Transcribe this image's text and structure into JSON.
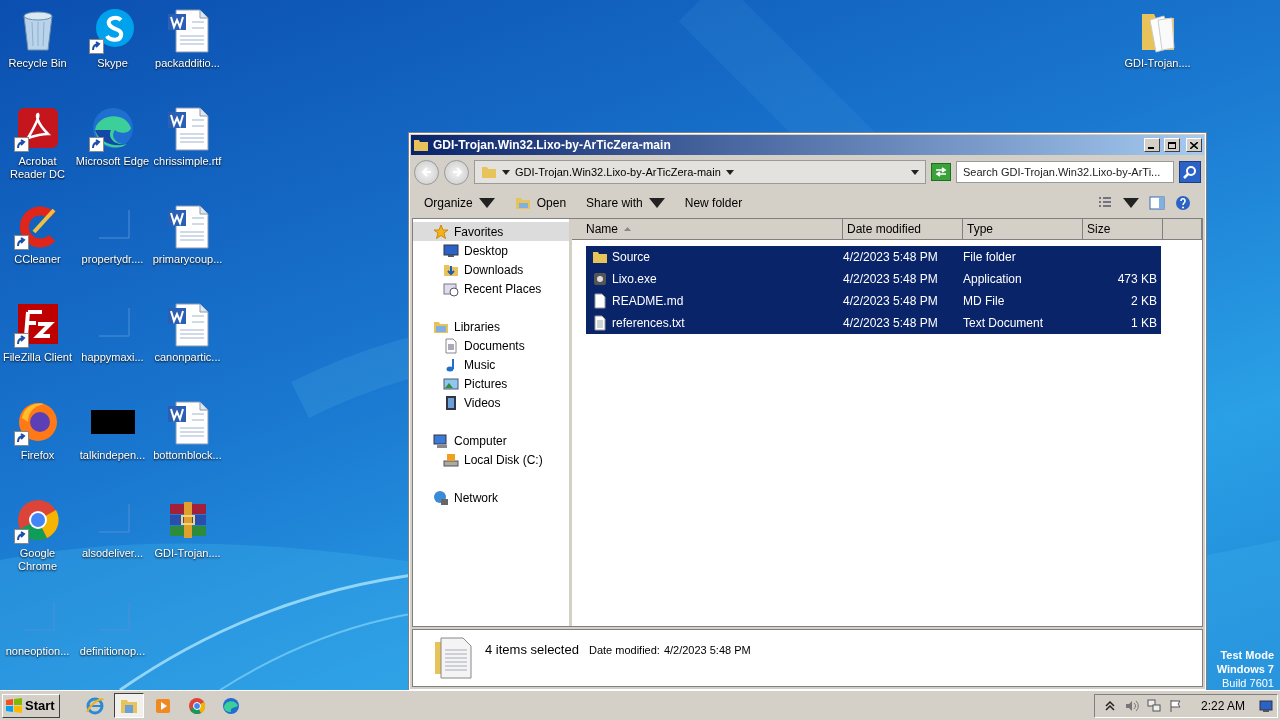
{
  "desktop": {
    "icons": [
      {
        "label": "Recycle Bin",
        "kind": "recycle",
        "shortcut": false
      },
      {
        "label": "Acrobat Reader DC",
        "kind": "acrobat",
        "shortcut": true
      },
      {
        "label": "CCleaner",
        "kind": "ccleaner",
        "shortcut": true
      },
      {
        "label": "FileZilla Client",
        "kind": "filezilla",
        "shortcut": true
      },
      {
        "label": "Firefox",
        "kind": "firefox",
        "shortcut": true
      },
      {
        "label": "Google Chrome",
        "kind": "chrome",
        "shortcut": true
      },
      {
        "label": "noneoption...",
        "kind": "blank",
        "shortcut": false
      },
      {
        "label": "Skype",
        "kind": "skype",
        "shortcut": true
      },
      {
        "label": "Microsoft Edge",
        "kind": "edge",
        "shortcut": true
      },
      {
        "label": "propertydr....",
        "kind": "blank",
        "shortcut": false
      },
      {
        "label": "happymaxi...",
        "kind": "blank",
        "shortcut": false
      },
      {
        "label": "talkindepen...",
        "kind": "black",
        "shortcut": false
      },
      {
        "label": "alsodeliver...",
        "kind": "blank",
        "shortcut": false
      },
      {
        "label": "definitionop...",
        "kind": "blank",
        "shortcut": false
      },
      {
        "label": "packadditio...",
        "kind": "word",
        "shortcut": false
      },
      {
        "label": "chrissimple.rtf",
        "kind": "word",
        "shortcut": false
      },
      {
        "label": "primarycoup...",
        "kind": "word",
        "shortcut": false
      },
      {
        "label": "canonpartic...",
        "kind": "word",
        "shortcut": false
      },
      {
        "label": "bottomblock...",
        "kind": "word",
        "shortcut": false
      },
      {
        "label": "GDI-Trojan....",
        "kind": "winrar",
        "shortcut": false
      }
    ],
    "corner_icon": {
      "label": "GDI-Trojan....",
      "kind": "folder",
      "shortcut": false
    }
  },
  "explorer": {
    "title": "GDI-Trojan.Win32.Lixo-by-ArTicZera-main",
    "address": {
      "path": "GDI-Trojan.Win32.Lixo-by-ArTicZera-main"
    },
    "search": {
      "placeholder": "Search GDI-Trojan.Win32.Lixo-by-ArTi..."
    },
    "toolbar": [
      {
        "label": "Organize",
        "kind": "menu"
      },
      {
        "label": "Open",
        "kind": "open"
      },
      {
        "label": "Share with",
        "kind": "menu"
      },
      {
        "label": "New folder",
        "kind": "plain"
      }
    ],
    "nav": [
      {
        "label": "Favorites",
        "kind": "star",
        "selected": true,
        "children": [
          {
            "label": "Desktop",
            "kind": "desktop",
            "selected": false
          },
          {
            "label": "Downloads",
            "kind": "downloads",
            "selected": false
          },
          {
            "label": "Recent Places",
            "kind": "recent",
            "selected": false
          }
        ]
      },
      {
        "label": "Libraries",
        "kind": "library",
        "selected": false,
        "children": [
          {
            "label": "Documents",
            "kind": "documents",
            "selected": false
          },
          {
            "label": "Music",
            "kind": "music",
            "selected": false
          },
          {
            "label": "Pictures",
            "kind": "pictures",
            "selected": false
          },
          {
            "label": "Videos",
            "kind": "videos",
            "selected": false
          }
        ]
      },
      {
        "label": "Computer",
        "kind": "computer",
        "selected": false,
        "children": [
          {
            "label": "Local Disk (C:)",
            "kind": "disk",
            "selected": false
          }
        ]
      },
      {
        "label": "Network",
        "kind": "network",
        "selected": false
      }
    ],
    "columns": [
      {
        "label": "Name",
        "sorted": true
      },
      {
        "label": "Date modified",
        "sorted": false
      },
      {
        "label": "Type",
        "sorted": false
      },
      {
        "label": "Size",
        "sorted": false
      }
    ],
    "files": [
      {
        "name": "Source",
        "date": "4/2/2023 5:48 PM",
        "type": "File folder",
        "kind": "folder",
        "selected": true
      },
      {
        "name": "Lixo.exe",
        "date": "4/2/2023 5:48 PM",
        "type": "Application",
        "size": "473 KB",
        "kind": "exe",
        "selected": true
      },
      {
        "name": "README.md",
        "date": "4/2/2023 5:48 PM",
        "type": "MD File",
        "size": "2 KB",
        "kind": "blank",
        "selected": true
      },
      {
        "name": "references.txt",
        "date": "4/2/2023 5:48 PM",
        "type": "Text Document",
        "size": "1 KB",
        "kind": "text",
        "selected": true
      }
    ],
    "details": {
      "summary": "4 items selected",
      "date_label": "Date modified:",
      "date": "4/2/2023 5:48 PM"
    }
  },
  "os_notice": [
    {
      "text": "Test Mode",
      "bold": true
    },
    {
      "text": "Windows 7",
      "bold": true
    },
    {
      "text": "Build 7601",
      "bold": false
    }
  ],
  "taskbar": {
    "start": "Start",
    "pinned": [
      {
        "kind": "ie",
        "selected": false
      },
      {
        "kind": "explorer",
        "selected": true
      },
      {
        "kind": "media",
        "selected": false
      },
      {
        "kind": "chrome",
        "selected": false
      },
      {
        "kind": "edge",
        "selected": false
      }
    ],
    "clock": "2:22 AM"
  }
}
